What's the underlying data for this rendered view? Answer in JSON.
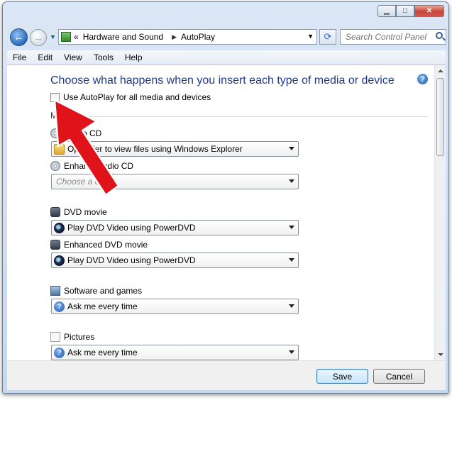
{
  "window": {
    "caption_buttons": [
      "minimize",
      "maximize",
      "close"
    ]
  },
  "nav": {
    "breadcrumb": [
      "Hardware and Sound",
      "AutoPlay"
    ],
    "overflow_glyph": "«",
    "search_placeholder": "Search Control Panel"
  },
  "menu": [
    "File",
    "Edit",
    "View",
    "Tools",
    "Help"
  ],
  "content": {
    "heading": "Choose what happens when you insert each type of media or device",
    "autoplay_checkbox_label": "Use AutoPlay for all media and devices",
    "autoplay_checked": false,
    "section_label": "M",
    "items": [
      {
        "label": "Audio CD",
        "visible_label": "o CD",
        "value": "Open folder to view files using Windows Explorer",
        "visible_value": "Op folder to view files using Windows Explorer",
        "icon": "audio-cd-icon"
      },
      {
        "label": "Enhanced audio CD",
        "visible_label": "Enhan d audio CD",
        "value": "",
        "placeholder": "Choose a default",
        "visible_placeholder": "Choose a d ult",
        "icon": "audio-cd-icon"
      },
      {
        "label": "DVD movie",
        "value": "Play DVD Video using PowerDVD",
        "icon": "dvd-icon"
      },
      {
        "label": "Enhanced DVD movie",
        "value": "Play DVD Video using PowerDVD",
        "icon": "dvd-icon"
      },
      {
        "label": "Software and games",
        "value": "Ask me every time",
        "icon": "software-icon"
      },
      {
        "label": "Pictures",
        "value": "Ask me every time",
        "icon": "pictures-icon"
      }
    ]
  },
  "footer": {
    "save_label": "Save",
    "cancel_label": "Cancel"
  },
  "colors": {
    "heading": "#1e3a8a",
    "annotation_arrow": "#e0121a",
    "save_border": "#3c7fb1"
  }
}
